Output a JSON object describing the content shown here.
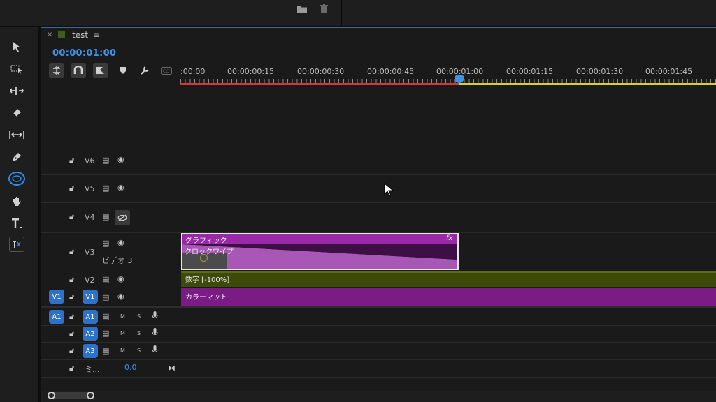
{
  "top": {
    "icons": [
      "folder-icon",
      "trash-icon"
    ]
  },
  "tools": [
    "selection-icon",
    "track-select-icon",
    "ripple-edit-icon",
    "razor-icon",
    "slip-icon",
    "pen-icon",
    "ellipse-icon",
    "hand-icon",
    "type-icon",
    "vertical-type-icon"
  ],
  "sequence": {
    "tab_close": "×",
    "tab_title": "test",
    "tab_menu": "≡",
    "timecode": "00:00:01:00",
    "swatch_color": "#3c5f1f"
  },
  "ruler": {
    "labels": [
      ":00:00",
      "00:00:00:15",
      "00:00:00:30",
      "00:00:00:45",
      "00:00:01:00",
      "00:00:01:15",
      "00:00:01:30",
      "00:00:01:45"
    ]
  },
  "tracks": {
    "video": [
      {
        "name": "V6"
      },
      {
        "name": "V5"
      },
      {
        "name": "V4"
      },
      {
        "name": "V3",
        "label": "ビデオ 3"
      },
      {
        "name": "V2"
      },
      {
        "name": "V1",
        "source": "V1"
      }
    ],
    "audio": [
      {
        "name": "A1",
        "source": "A1",
        "mute": "M",
        "solo": "S"
      },
      {
        "name": "A2",
        "mute": "M",
        "solo": "S"
      },
      {
        "name": "A3",
        "mute": "M",
        "solo": "S"
      }
    ],
    "mix": {
      "label": "ミ...",
      "value": "0.0"
    }
  },
  "clips": {
    "graphic": {
      "label": "グラフィック",
      "fx": "fx",
      "effect": "クロックワイプ"
    },
    "v2": {
      "label": "数字 [-100%]"
    },
    "v1": {
      "label": "カラーマット"
    }
  },
  "colors": {
    "accent": "#3d93e8",
    "graphic_clip": "#9a29a8",
    "color_matte_clip": "#7a1b86",
    "number_clip": "#3d4a0a",
    "work_area_red": "#d23a3a",
    "work_area_yellow": "#d8cf2b"
  }
}
